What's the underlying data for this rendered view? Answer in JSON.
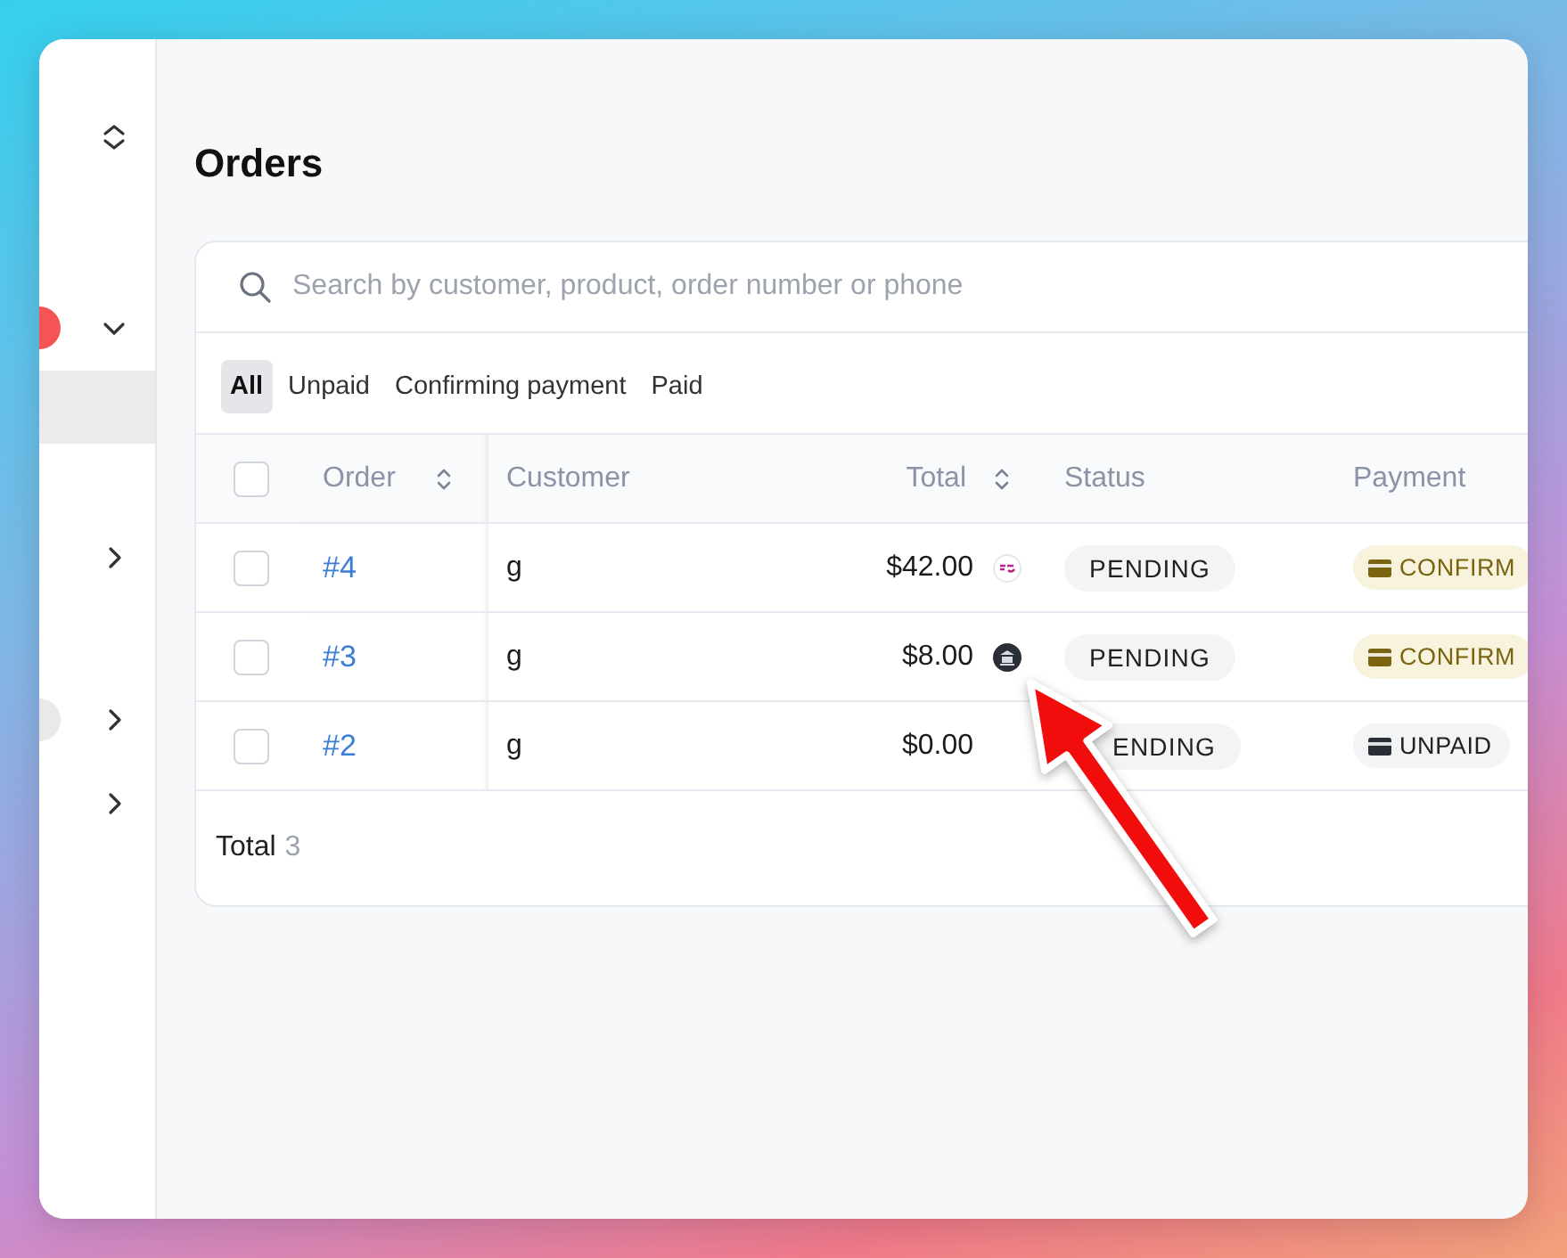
{
  "sidebar": {
    "items": [
      {
        "kind": "switcher",
        "selected": false
      },
      {
        "kind": "expandable",
        "expanded": true,
        "badge": {
          "color": "#f65454"
        },
        "selected": false
      },
      {
        "kind": "link",
        "selected": true
      },
      {
        "kind": "expandable",
        "expanded": false,
        "selected": false
      },
      {
        "kind": "expandable",
        "expanded": false,
        "badge": {
          "color": "#e9e9ea"
        },
        "selected": false
      },
      {
        "kind": "expandable",
        "expanded": false,
        "selected": false
      }
    ]
  },
  "page": {
    "title": "Orders"
  },
  "search": {
    "placeholder": "Search by customer, product, order number or phone"
  },
  "filters": [
    {
      "label": "All",
      "selected": true
    },
    {
      "label": "Unpaid",
      "selected": false
    },
    {
      "label": "Confirming payment",
      "selected": false
    },
    {
      "label": "Paid",
      "selected": false
    }
  ],
  "table": {
    "all_checked": false,
    "columns": [
      {
        "label": "Order",
        "sortable": true
      },
      {
        "label": "Customer",
        "sortable": false
      },
      {
        "label": "Total",
        "sortable": true
      },
      {
        "label": "Status",
        "sortable": false
      },
      {
        "label": "Payment",
        "sortable": false
      }
    ],
    "rows": [
      {
        "checked": false,
        "order": "#4",
        "customer": "g",
        "total": "$42.00",
        "total_icon": {
          "kind": "logo"
        },
        "status": "PENDING",
        "payment": {
          "kind": "confirming",
          "label": "CONFIRM"
        }
      },
      {
        "checked": false,
        "order": "#3",
        "customer": "g",
        "total": "$8.00",
        "total_icon": {
          "kind": "bank"
        },
        "status": "PENDING",
        "payment": {
          "kind": "confirming",
          "label": "CONFIRM"
        }
      },
      {
        "checked": false,
        "order": "#2",
        "customer": "g",
        "total": "$0.00",
        "status": "ENDING",
        "payment": {
          "kind": "unpaid",
          "label": "UNPAID"
        }
      }
    ]
  },
  "footer": {
    "label": "Total",
    "count": "3"
  },
  "annotation": {
    "kind": "arrow"
  }
}
